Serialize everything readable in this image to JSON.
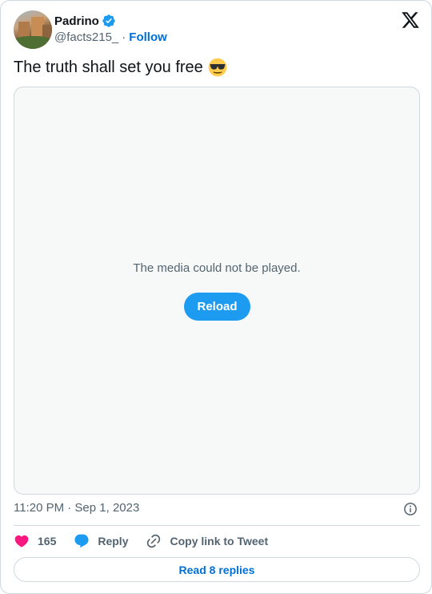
{
  "author": {
    "name": "Padrino",
    "handle": "@facts215_",
    "separator": "·",
    "follow_label": "Follow"
  },
  "tweet": {
    "text": "The truth shall set you free",
    "emoji": "smiling-face-with-sunglasses"
  },
  "media": {
    "error_message": "The media could not be played.",
    "reload_label": "Reload"
  },
  "meta": {
    "timestamp": "11:20 PM · Sep 1, 2023"
  },
  "actions": {
    "like_count": "165",
    "reply_label": "Reply",
    "copy_link_label": "Copy link to Tweet"
  },
  "footer": {
    "read_replies_label": "Read 8 replies"
  },
  "colors": {
    "accent": "#1d9bf0",
    "link": "#006fd6",
    "like": "#f91880",
    "secondary_text": "#536471",
    "border": "#cfd9de"
  },
  "icons": [
    "verified-badge-icon",
    "x-logo-icon",
    "sunglasses-emoji-icon",
    "info-icon",
    "heart-icon",
    "reply-bubble-icon",
    "link-icon"
  ]
}
